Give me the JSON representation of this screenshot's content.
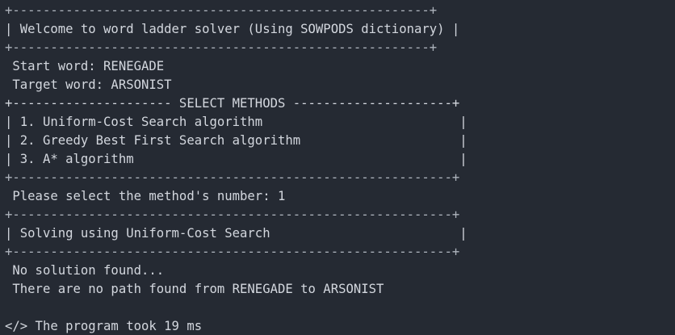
{
  "terminal": {
    "lines": [
      "+-------------------------------------------------------+",
      "| Welcome to word ladder solver (Using SOWPODS dictionary) |",
      "+-------------------------------------------------------+",
      " Start word: RENEGADE",
      " Target word: ARSONIST",
      "+--------------------- SELECT METHODS ---------------------+",
      "| 1. Uniform-Cost Search algorithm                          |",
      "| 2. Greedy Best First Search algorithm                     |",
      "| 3. A* algorithm                                           |",
      "+----------------------------------------------------------+",
      " Please select the method's number: 1",
      "+----------------------------------------------------------+",
      "| Solving using Uniform-Cost Search                         |",
      "+----------------------------------------------------------+",
      " No solution found...",
      " There are no path found from RENEGADE to ARSONIST",
      "",
      "</> The program took 19 ms"
    ]
  }
}
